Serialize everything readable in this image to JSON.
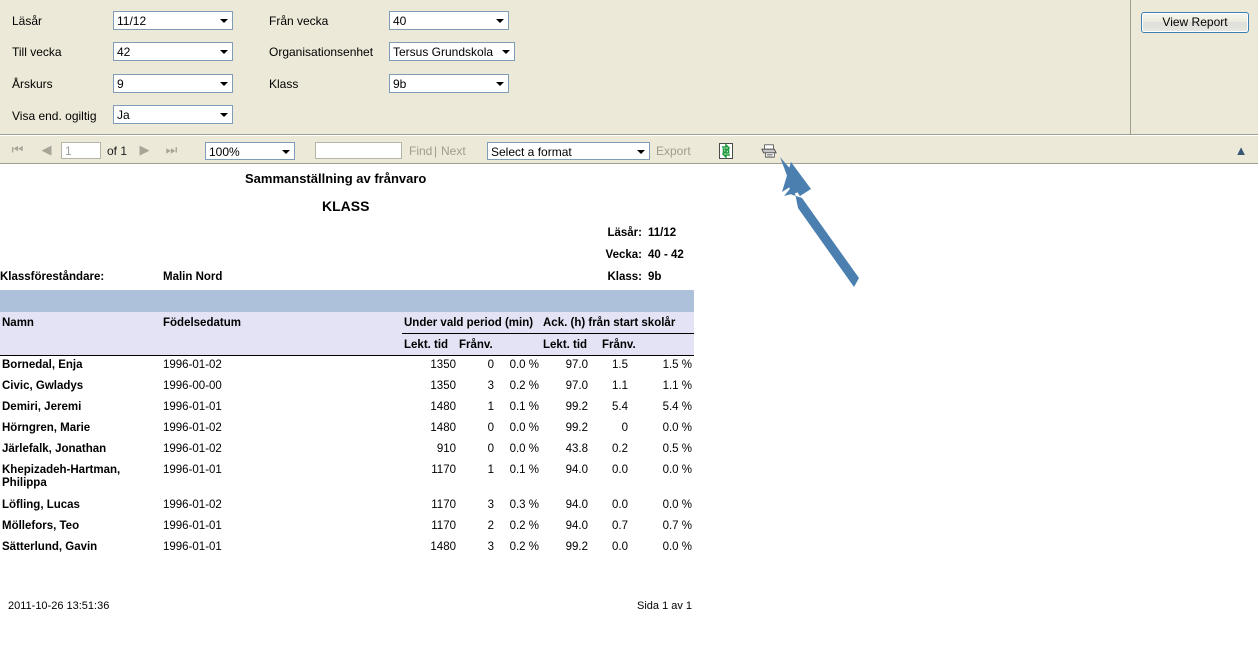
{
  "params": {
    "fields": [
      {
        "label": "Läsår",
        "value": "11/12"
      },
      {
        "label": "Till vecka",
        "value": "42"
      },
      {
        "label": "Årskurs",
        "value": "9"
      },
      {
        "label": "Visa end. ogiltig",
        "value": "Ja"
      },
      {
        "label": "Från vecka",
        "value": "40"
      },
      {
        "label": "Organisationsenhet",
        "value": "Tersus Grundskola"
      },
      {
        "label": "Klass",
        "value": "9b"
      }
    ],
    "view_report_label": "View Report"
  },
  "toolbar": {
    "first_icon": "first-page-icon",
    "prev_icon": "previous-page-icon",
    "page_value": "1",
    "page_of": "of 1",
    "next_icon": "next-page-icon",
    "last_icon": "last-page-icon",
    "zoom_value": "100%",
    "find_value": "",
    "find_label": "Find",
    "find_separator": "|",
    "next_label": "Next",
    "format_value": "Select a format",
    "export_label": "Export",
    "refresh_icon": "refresh-icon",
    "print_icon": "print-icon",
    "collapse_icon": "collapse-chevron-icon"
  },
  "report": {
    "title": "Sammanställning av frånvaro",
    "subtitle": "KLASS",
    "meta": {
      "lasar_label": "Läsår:",
      "lasar_value": "11/12",
      "vecka_label": "Vecka:",
      "vecka_value": "40 - 42",
      "klass_label": "Klass:",
      "klass_value": "9b"
    },
    "teacher_label": "Klassföreståndare:",
    "teacher_value": "Malin Nord",
    "columns": {
      "namn": "Namn",
      "fodelsedatum": "Födelsedatum",
      "group_under": "Under vald period (min)",
      "group_ack": "Ack. (h) från start skolår",
      "lekt_tid_1": "Lekt. tid",
      "franv_1": "Frånv.",
      "lekt_tid_2": "Lekt. tid",
      "franv_2": "Frånv."
    },
    "rows": [
      {
        "namn": "Bornedal, Enja",
        "birth": "1996-01-02",
        "lekt1": "1350",
        "franv1": "0",
        "pct1": "0.0 %",
        "lekt2": "97.0",
        "franv2": "1.5",
        "pct2": "1.5 %",
        "tall": false
      },
      {
        "namn": "Civic, Gwladys",
        "birth": "1996-00-00",
        "lekt1": "1350",
        "franv1": "3",
        "pct1": "0.2 %",
        "lekt2": "97.0",
        "franv2": "1.1",
        "pct2": "1.1 %",
        "tall": false
      },
      {
        "namn": "Demiri, Jeremi",
        "birth": "1996-01-01",
        "lekt1": "1480",
        "franv1": "1",
        "pct1": "0.1 %",
        "lekt2": "99.2",
        "franv2": "5.4",
        "pct2": "5.4 %",
        "tall": false
      },
      {
        "namn": "Hörngren, Marie",
        "birth": "1996-01-02",
        "lekt1": "1480",
        "franv1": "0",
        "pct1": "0.0 %",
        "lekt2": "99.2",
        "franv2": "0",
        "pct2": "0.0 %",
        "tall": false
      },
      {
        "namn": "Järlefalk, Jonathan",
        "birth": "1996-01-02",
        "lekt1": "910",
        "franv1": "0",
        "pct1": "0.0 %",
        "lekt2": "43.8",
        "franv2": "0.2",
        "pct2": "0.5 %",
        "tall": false
      },
      {
        "namn": "Khepizadeh-Hartman, Philippa",
        "birth": "1996-01-01",
        "lekt1": "1170",
        "franv1": "1",
        "pct1": "0.1 %",
        "lekt2": "94.0",
        "franv2": "0.0",
        "pct2": "0.0 %",
        "tall": true
      },
      {
        "namn": "Löfling, Lucas",
        "birth": "1996-01-02",
        "lekt1": "1170",
        "franv1": "3",
        "pct1": "0.3 %",
        "lekt2": "94.0",
        "franv2": "0.0",
        "pct2": "0.0 %",
        "tall": false
      },
      {
        "namn": "Möllefors, Teo",
        "birth": "1996-01-01",
        "lekt1": "1170",
        "franv1": "2",
        "pct1": "0.2 %",
        "lekt2": "94.0",
        "franv2": "0.7",
        "pct2": "0.7 %",
        "tall": false
      },
      {
        "namn": "Sätterlund, Gavin",
        "birth": "1996-01-01",
        "lekt1": "1480",
        "franv1": "3",
        "pct1": "0.2 %",
        "lekt2": "99.2",
        "franv2": "0.0",
        "pct2": "0.0 %",
        "tall": false
      }
    ],
    "footer_timestamp": "2011-10-26 13:51:36",
    "footer_page": "Sida 1 av 1"
  },
  "annotation": {
    "arrow_icon": "annotation-arrow-icon",
    "arrow_color": "#4a7fb0"
  },
  "colors": {
    "panel_bg": "#ece9d8",
    "band": "#aec1da",
    "header_row": "#e3e3f5",
    "accent": "#3c7fb1"
  }
}
